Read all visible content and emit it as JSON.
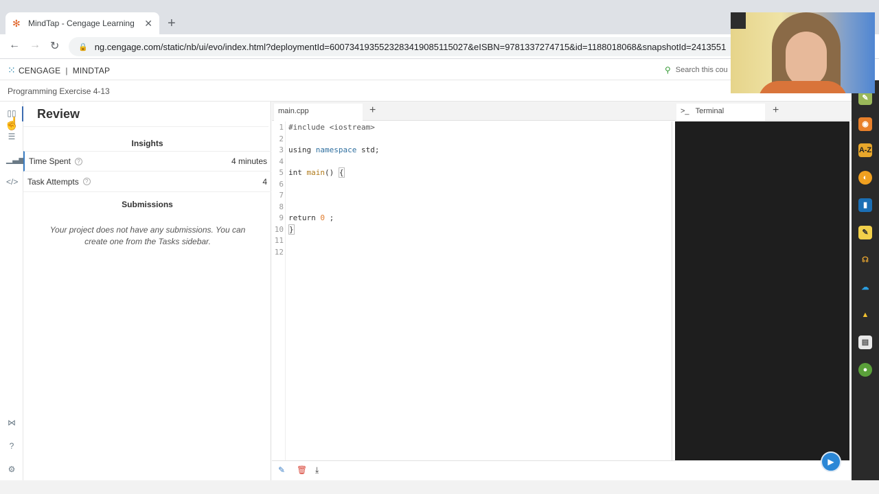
{
  "browser": {
    "tab_title": "MindTap - Cengage Learning",
    "tab_close": "✕",
    "new_tab": "+",
    "url": "ng.cengage.com/static/nb/ui/evo/index.html?deploymentId=6007341935523283419085115027&eISBN=9781337274715&id=1188018068&snapshotId=2413551"
  },
  "app": {
    "brand_left": "CENGAGE",
    "brand_right": "MINDTAP",
    "search_placeholder": "Search this cou",
    "breadcrumb": "Programming Exercise 4-13"
  },
  "review": {
    "title": "Review",
    "insights_heading": "Insights",
    "rows": [
      {
        "label": "Time Spent",
        "value": "4 minutes"
      },
      {
        "label": "Task Attempts",
        "value": "4"
      }
    ],
    "submissions_heading": "Submissions",
    "empty_message": "Your project does not have any submissions. You can create one from the Tasks sidebar."
  },
  "editor": {
    "file_tab": "main.cpp",
    "add_tab": "+",
    "line_numbers": [
      "1",
      "2",
      "3",
      "4",
      "5",
      "6",
      "7",
      "8",
      "9",
      "10",
      "11",
      "12"
    ],
    "code": {
      "l1": "#include <iostream>",
      "l3a": "using ",
      "l3b": "namespace",
      "l3c": " std;",
      "l5a": "int ",
      "l5b": "main",
      "l5c": "() ",
      "l5d": "{",
      "l9a": "return ",
      "l9b": "0",
      "l9c": " ;",
      "l10": "}"
    }
  },
  "terminal": {
    "tab_label": "Terminal",
    "prompt_icon": ">_",
    "add_tab": "+"
  },
  "colors": {
    "accent": "#3b7ec5",
    "terminal_bg": "#1e1e1e",
    "keyword": "#2f6f9f",
    "number": "#e07a2a"
  }
}
